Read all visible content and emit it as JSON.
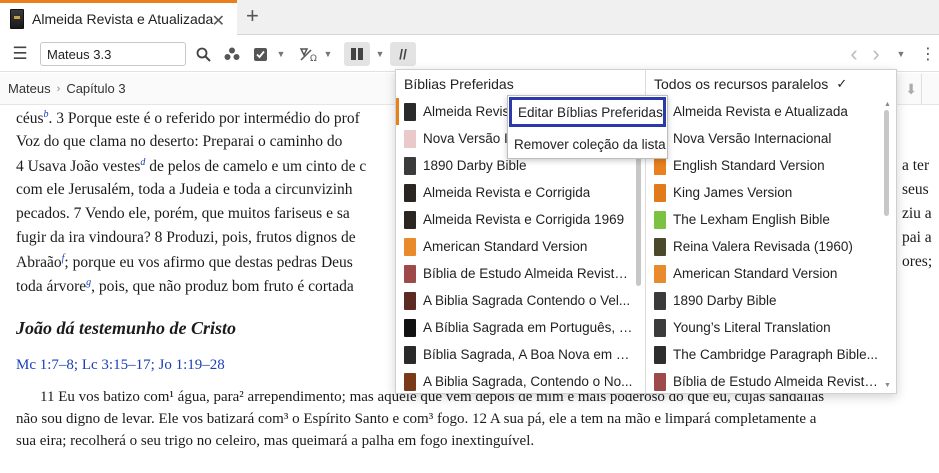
{
  "tab": {
    "title": "Almeida Revista e Atualizada",
    "close": "✕",
    "add": "+"
  },
  "toolbar": {
    "menu": "☰",
    "reference": "Mateus 3.3",
    "parallel": "//",
    "back": "‹",
    "forward": "›"
  },
  "breadcrumb": {
    "book": "Mateus",
    "chapter": "Capítulo 3"
  },
  "reader": {
    "lines": [
      {
        "a": "céus",
        "fn": "b",
        "b": ". 3 Porque este é o referido por intermédio do prof"
      },
      {
        "a": "     Voz do que clama no deserto: Preparai o caminho do"
      },
      {
        "a": "4 Usava João vestes",
        "fn": "d",
        "b": " de pelos de camelo e um cinto de c"
      },
      {
        "a": "com ele Jerusalém, toda a Judeia e toda a circunvizinh"
      },
      {
        "a": "pecados. 7 Vendo ele, porém, que muitos fariseus e sa"
      },
      {
        "a": "fugir da ira vindoura? 8 Produzi, pois, frutos dignos de"
      },
      {
        "a": "Abraão",
        "fn": "f",
        "b": "; porque eu vos afirmo que destas pedras Deus"
      },
      {
        "a": "toda árvore",
        "fn": "g",
        "b": ", pois, que não produz bom fruto é cortada"
      }
    ],
    "right_fragments": [
      "a ter",
      "seus",
      "ziu a",
      "pai a",
      "ores;"
    ],
    "heading": "João dá testemunho de Cristo",
    "xrefs": "Mc 1:7–8; Lc 3:15–17; Jo 1:19–28",
    "p2": [
      "11 Eu vos batizo com¹ água, para² arrependimento; mas aquele que vem depois de mim é mais poderoso do que eu, cujas sandálias",
      "não sou digno de levar. Ele vos batizará com³ o Espírito Santo e com³ fogo. 12 A sua pá, ele a tem na mão e limpará completamente a",
      "sua eira; recolherá o seu trigo no celeiro, mas queimará a palha em fogo inextinguível."
    ]
  },
  "panel": {
    "left_header": "Bíblias Preferidas",
    "right_header": "Todos os recursos paralelos",
    "right_check": "✓",
    "left_items": [
      {
        "label": "Almeida Revista e Atualizada",
        "color": "#2a2a2a"
      },
      {
        "label": "Nova Versão Internacional",
        "color": "#e9c9c9"
      },
      {
        "label": "1890 Darby Bible",
        "color": "#3b3b3b"
      },
      {
        "label": "Almeida Revista e Corrigida",
        "color": "#2b2622"
      },
      {
        "label": "Almeida Revista e Corrigida 1969",
        "color": "#2b2622"
      },
      {
        "label": "American Standard Version",
        "color": "#e98a2c"
      },
      {
        "label": "Bíblia de Estudo Almeida Revista...",
        "color": "#9e4a4a"
      },
      {
        "label": "A Biblia Sagrada Contendo o Vel...",
        "color": "#5c2a22"
      },
      {
        "label": "A Bíblia Sagrada em Português, E...",
        "color": "#111111"
      },
      {
        "label": "Bíblia Sagrada, A Boa Nova em P...",
        "color": "#2a2a2a"
      },
      {
        "label": "A Biblia Sagrada, Contendo o No...",
        "color": "#7a3a1a"
      }
    ],
    "right_items": [
      {
        "label": "Almeida Revista e Atualizada",
        "color": "#2a2a2a"
      },
      {
        "label": "Nova Versão Internacional",
        "color": "#e9c9c9"
      },
      {
        "label": "English Standard Version",
        "color": "#e8801e"
      },
      {
        "label": "King James Version",
        "color": "#e07a1a"
      },
      {
        "label": "The Lexham English Bible",
        "color": "#7cc242"
      },
      {
        "label": "Reina Valera Revisada (1960)",
        "color": "#4a4a2a"
      },
      {
        "label": "American Standard Version",
        "color": "#e98a2c"
      },
      {
        "label": "1890 Darby Bible",
        "color": "#3b3b3b"
      },
      {
        "label": "Young’s Literal Translation",
        "color": "#3b3b3b"
      },
      {
        "label": "The Cambridge Paragraph Bible...",
        "color": "#2e2e2e"
      },
      {
        "label": "Bíblia de Estudo Almeida Revista...",
        "color": "#9e4a4a"
      }
    ]
  },
  "context_menu": {
    "edit": "Editar Bíblias Preferidas",
    "remove": "Remover coleção da lista"
  }
}
